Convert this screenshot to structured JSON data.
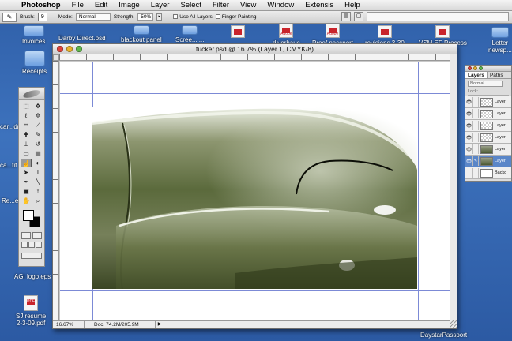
{
  "menubar": {
    "app": "Photoshop",
    "items": [
      "File",
      "Edit",
      "Image",
      "Layer",
      "Select",
      "Filter",
      "View",
      "Window",
      "Extensis",
      "Help"
    ]
  },
  "options_bar": {
    "brush_label": "Brush:",
    "brush_size": "9",
    "mode_label": "Mode:",
    "mode_value": "Normal",
    "strength_label": "Strength:",
    "strength_value": "50%",
    "sample_all_layers": "Use All Layers",
    "finger_painting": "Finger Painting"
  },
  "desktop_icons": [
    {
      "label": "Invoices",
      "type": "folder"
    },
    {
      "label": "Receipts",
      "type": "folder"
    },
    {
      "label": "AGI logo.eps",
      "type": "eps"
    },
    {
      "label": "SJ resume",
      "label2": "2-3-09.pdf",
      "type": "pdf",
      "badge": "PDF"
    }
  ],
  "top_icons": [
    {
      "label": "Darby Direct.psd",
      "type": "file"
    },
    {
      "label": "blackout panel",
      "type": "folder"
    },
    {
      "label": "Scree... ...",
      "type": "folder"
    },
    {
      "label": "diverhaus",
      "type": "pdf",
      "badge": "Adobe"
    },
    {
      "label": "Proof.passport",
      "type": "pdf",
      "badge": "Adobe"
    },
    {
      "label": "revisions 3-30",
      "type": "file"
    },
    {
      "label": "VSM EF Process",
      "type": "file"
    },
    {
      "label": "Letter",
      "label2": "newsp...",
      "type": "folder"
    }
  ],
  "left_partial_labels": [
    "car...dm",
    "ca...tif",
    "Re...el.j"
  ],
  "bottom_right_label": "DaystarPassport",
  "document": {
    "title": "tucker.psd @ 16.7% (Layer 1, CMYK/8)",
    "zoom": "16.67%",
    "doc_info": "Doc: 74.2M/205.9M"
  },
  "layers_panel": {
    "tabs": [
      "Layers",
      "Paths"
    ],
    "blend_mode": "Normal",
    "lock_label": "Lock:",
    "layers": [
      {
        "name": "Layer",
        "thumb": "transparent",
        "selected": false
      },
      {
        "name": "Layer",
        "thumb": "transparent",
        "selected": false
      },
      {
        "name": "Layer",
        "thumb": "transparent",
        "selected": false
      },
      {
        "name": "Layer",
        "thumb": "transparent",
        "selected": false
      },
      {
        "name": "Layer",
        "thumb": "car",
        "selected": false
      },
      {
        "name": "Layer",
        "thumb": "car",
        "selected": true
      },
      {
        "name": "Backg",
        "thumb": "white",
        "selected": false
      }
    ]
  },
  "colors": {
    "desktop": "#3d72bd",
    "foreground": "#ffffff",
    "background": "#000000",
    "car_body": "#5b6a3c",
    "guides": "#7c8ad6"
  }
}
